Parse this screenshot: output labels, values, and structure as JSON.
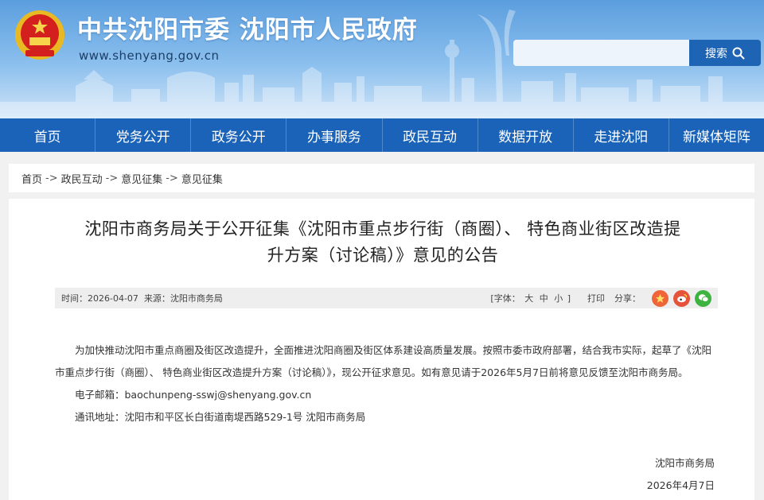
{
  "header": {
    "title": "中共沈阳市委  沈阳市人民政府",
    "url": "www.shenyang.gov.cn",
    "search": {
      "placeholder": "",
      "button_label": "搜索",
      "icon": "search-icon"
    }
  },
  "nav": {
    "items": [
      {
        "label": "首页"
      },
      {
        "label": "党务公开"
      },
      {
        "label": "政务公开"
      },
      {
        "label": "办事服务"
      },
      {
        "label": "政民互动"
      },
      {
        "label": "数据开放"
      },
      {
        "label": "走进沈阳"
      },
      {
        "label": "新媒体矩阵"
      }
    ]
  },
  "breadcrumb": {
    "items": [
      "首页",
      "政民互动",
      "意见征集",
      "意见征集"
    ],
    "separator": "->"
  },
  "article": {
    "title_line1": "沈阳市商务局关于公开征集《沈阳市重点步行街（商圈）、 特色商业街区改造提",
    "title_line2": "升方案（讨论稿）》意见的公告",
    "meta": {
      "time": "时间：2026-04-07",
      "source": "来源：沈阳市商务局",
      "font_label_prefix": "[字体：",
      "font_large": "大",
      "font_medium": "中",
      "font_small": "小",
      "font_label_suffix": "]",
      "print": "打印",
      "share": "分享："
    },
    "share_icons": [
      {
        "name": "qzone-icon",
        "color": "#f0643a"
      },
      {
        "name": "weibo-icon",
        "color": "#e5533b"
      },
      {
        "name": "wechat-icon",
        "color": "#3db340"
      }
    ],
    "paragraph": "为加快推动沈阳市重点商圈及街区改造提升，全面推进沈阳商圈及街区体系建设高质量发展。按照市委市政府部署，结合我市实际，起草了《沈阳市重点步行街（商圈）、 特色商业街区改造提升方案（讨论稿）》，现公开征求意见。如有意见请于2026年5月7日前将意见反馈至沈阳市商务局。",
    "email": "电子邮箱：baochunpeng-sswj@shenyang.gov.cn",
    "address": "通讯地址：沈阳市和平区长白街道南堤西路529-1号 沈阳市商务局",
    "signature": "沈阳市商务局",
    "date": "2026年4月7日"
  },
  "colors": {
    "header_top": "#5b9ede",
    "nav_bg": "#1a63b8",
    "search_button": "#1e64b4",
    "page_bg": "#f1f1f1"
  }
}
